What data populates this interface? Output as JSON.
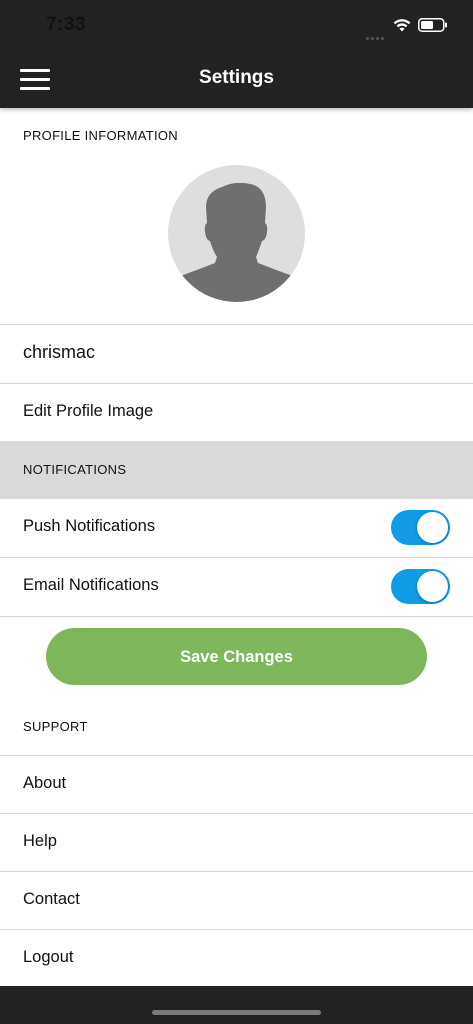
{
  "status_bar": {
    "time": "7:33"
  },
  "nav": {
    "title": "Settings",
    "menu_icon": "hamburger-menu-icon"
  },
  "profile": {
    "section_label": "PROFILE INFORMATION",
    "avatar_icon": "person-silhouette-icon",
    "username": "chrismac",
    "edit_image_label": "Edit Profile Image"
  },
  "notifications": {
    "section_label": "NOTIFICATIONS",
    "items": [
      {
        "label": "Push Notifications",
        "enabled": true
      },
      {
        "label": "Email Notifications",
        "enabled": true
      }
    ]
  },
  "actions": {
    "save_label": "Save Changes"
  },
  "support": {
    "section_label": "SUPPORT",
    "items": [
      {
        "label": "About"
      },
      {
        "label": "Help"
      },
      {
        "label": "Contact"
      },
      {
        "label": "Logout"
      }
    ]
  },
  "colors": {
    "bar_background": "#222222",
    "toggle_on": "#0f9ce4",
    "save_button": "#7db65b",
    "section_gray": "#d9d9d9"
  }
}
